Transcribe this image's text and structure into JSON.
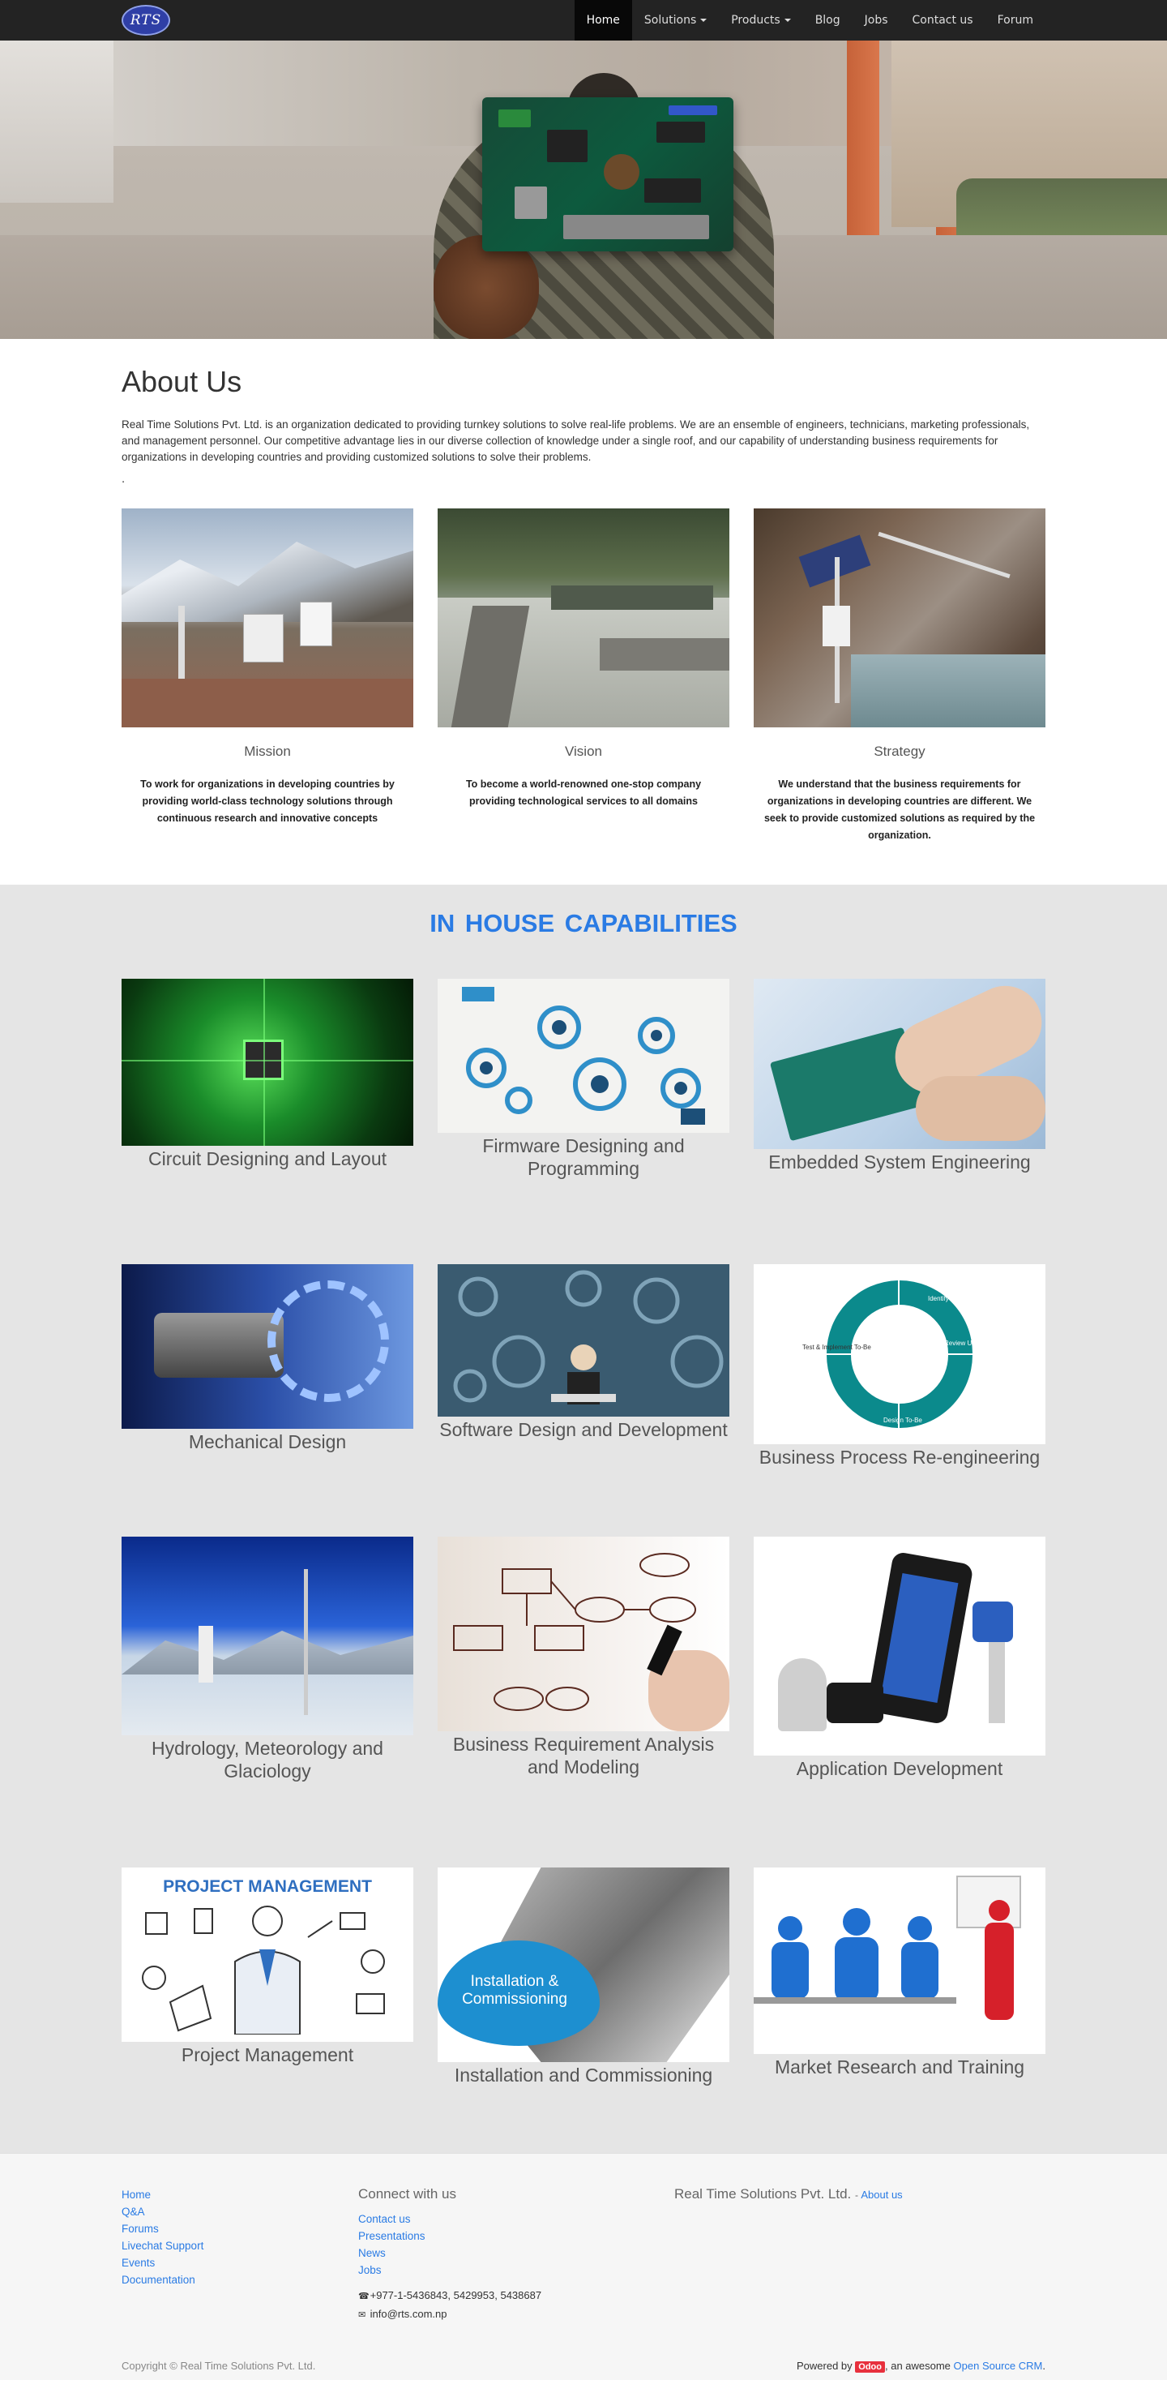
{
  "nav": {
    "logo_text": "RTS",
    "items": [
      {
        "label": "Home",
        "active": true,
        "dropdown": false
      },
      {
        "label": "Solutions",
        "active": false,
        "dropdown": true
      },
      {
        "label": "Products",
        "active": false,
        "dropdown": true
      },
      {
        "label": "Blog",
        "active": false,
        "dropdown": false
      },
      {
        "label": "Jobs",
        "active": false,
        "dropdown": false
      },
      {
        "label": "Contact us",
        "active": false,
        "dropdown": false
      },
      {
        "label": "Forum",
        "active": false,
        "dropdown": false
      }
    ]
  },
  "about": {
    "title": "About Us",
    "text": "Real Time Solutions Pvt. Ltd. is an organization dedicated to providing turnkey solutions to solve real-life problems. We are an ensemble of engineers, technicians, marketing professionals, and management personnel. Our competitive advantage lies in our diverse collection of knowledge under a single roof, and our capability of understanding business requirements for organizations in developing countries and providing customized solutions to solve their problems.",
    "dot": ".",
    "cards": [
      {
        "title": "Mission",
        "desc": "To work for organizations in developing countries by providing world-class technology solutions through continuous research and innovative concepts"
      },
      {
        "title": "Vision",
        "desc": "To become a world-renowned one-stop company providing technological services to all domains"
      },
      {
        "title": "Strategy",
        "desc": "We understand that the business requirements for organizations in developing countries are different. We seek to provide customized solutions as required by the organization."
      }
    ]
  },
  "capabilities": {
    "title": "IN HOUSE  CAPABILITIES",
    "items": [
      "Circuit Designing and Layout",
      "Firmware Designing and Programming",
      "Embedded System Engineering",
      "Mechanical Design",
      "Software Design and Development",
      "Business Process Re-engineering",
      "Hydrology, Meteorology and Glaciology",
      "Business Requirement Analysis and Modeling",
      "Application Development",
      "Project Management",
      "Installation and Commissioning",
      "Market Research and Training"
    ],
    "image_text": {
      "project_management": "PROJECT MANAGEMENT",
      "installation": "Installation & Commissioning",
      "bpr_steps": [
        "Identify Processes",
        "Review Update Analyze As-Is",
        "Design To-Be",
        "Test & Implement To-Be"
      ]
    }
  },
  "footer": {
    "links": [
      "Home",
      "Q&A",
      "Forums",
      "Livechat Support",
      "Events",
      "Documentation"
    ],
    "connect_title": "Connect with us",
    "connect_links": [
      "Contact us",
      "Presentations",
      "News",
      "Jobs"
    ],
    "phone": "+977-1-5436843, 5429953, 5438687",
    "email": "info@rts.com.np",
    "company_name": "Real Time Solutions Pvt. Ltd.",
    "company_link": "About us",
    "copyright": "Copyright © Real Time Solutions Pvt. Ltd.",
    "powered_prefix": "Powered by",
    "odoo": "Odoo",
    "powered_mid": ", an awesome",
    "crm_link": "Open Source CRM",
    "powered_end": "."
  }
}
